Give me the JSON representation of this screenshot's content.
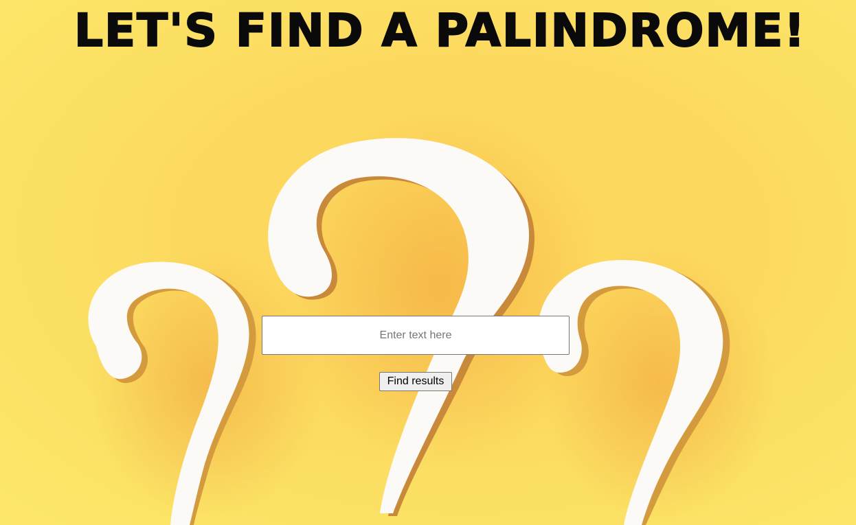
{
  "page": {
    "title": "LET'S FIND A PALINDROME!",
    "background_image": "question-marks-icon"
  },
  "form": {
    "input_value": "",
    "input_placeholder": "Enter text here",
    "submit_label": "Find results"
  },
  "colors": {
    "background": "#fcd95f",
    "title_text": "#0a0a0a",
    "question_mark": "#fbfaf7"
  }
}
